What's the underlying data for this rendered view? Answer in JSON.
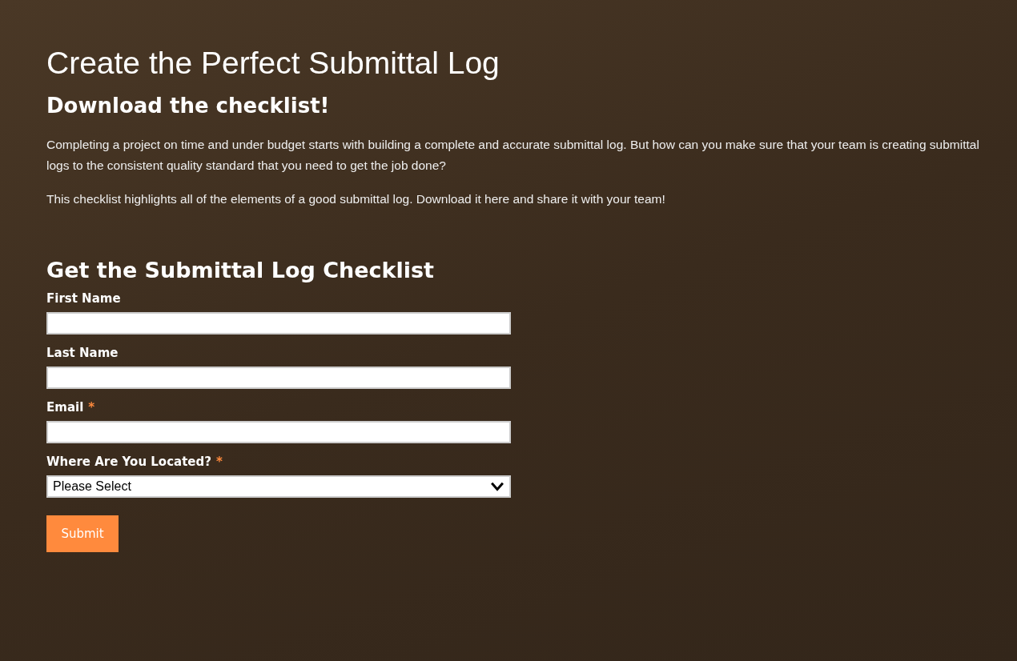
{
  "page": {
    "title": "Create the Perfect Submittal Log",
    "subtitle": "Download the checklist!",
    "paragraphs": [
      "Completing a project on time and under budget starts with building a complete and accurate submittal log. But how can you make sure that your team is creating submittal logs to the consistent quality standard that you need to get the job done?",
      "This checklist highlights all of the elements of a good submittal log. Download it here and share it with your team!"
    ]
  },
  "form": {
    "title": "Get the Submittal Log Checklist",
    "fields": [
      {
        "kind": "text",
        "label": "First Name"
      },
      {
        "kind": "text",
        "label": "Last Name"
      },
      {
        "kind": "text",
        "label": "Email",
        "required_mark": "*"
      },
      {
        "kind": "select",
        "label": "Where Are You Located?",
        "required_mark": "*",
        "value": "Please Select"
      }
    ],
    "submit": "Submit"
  }
}
